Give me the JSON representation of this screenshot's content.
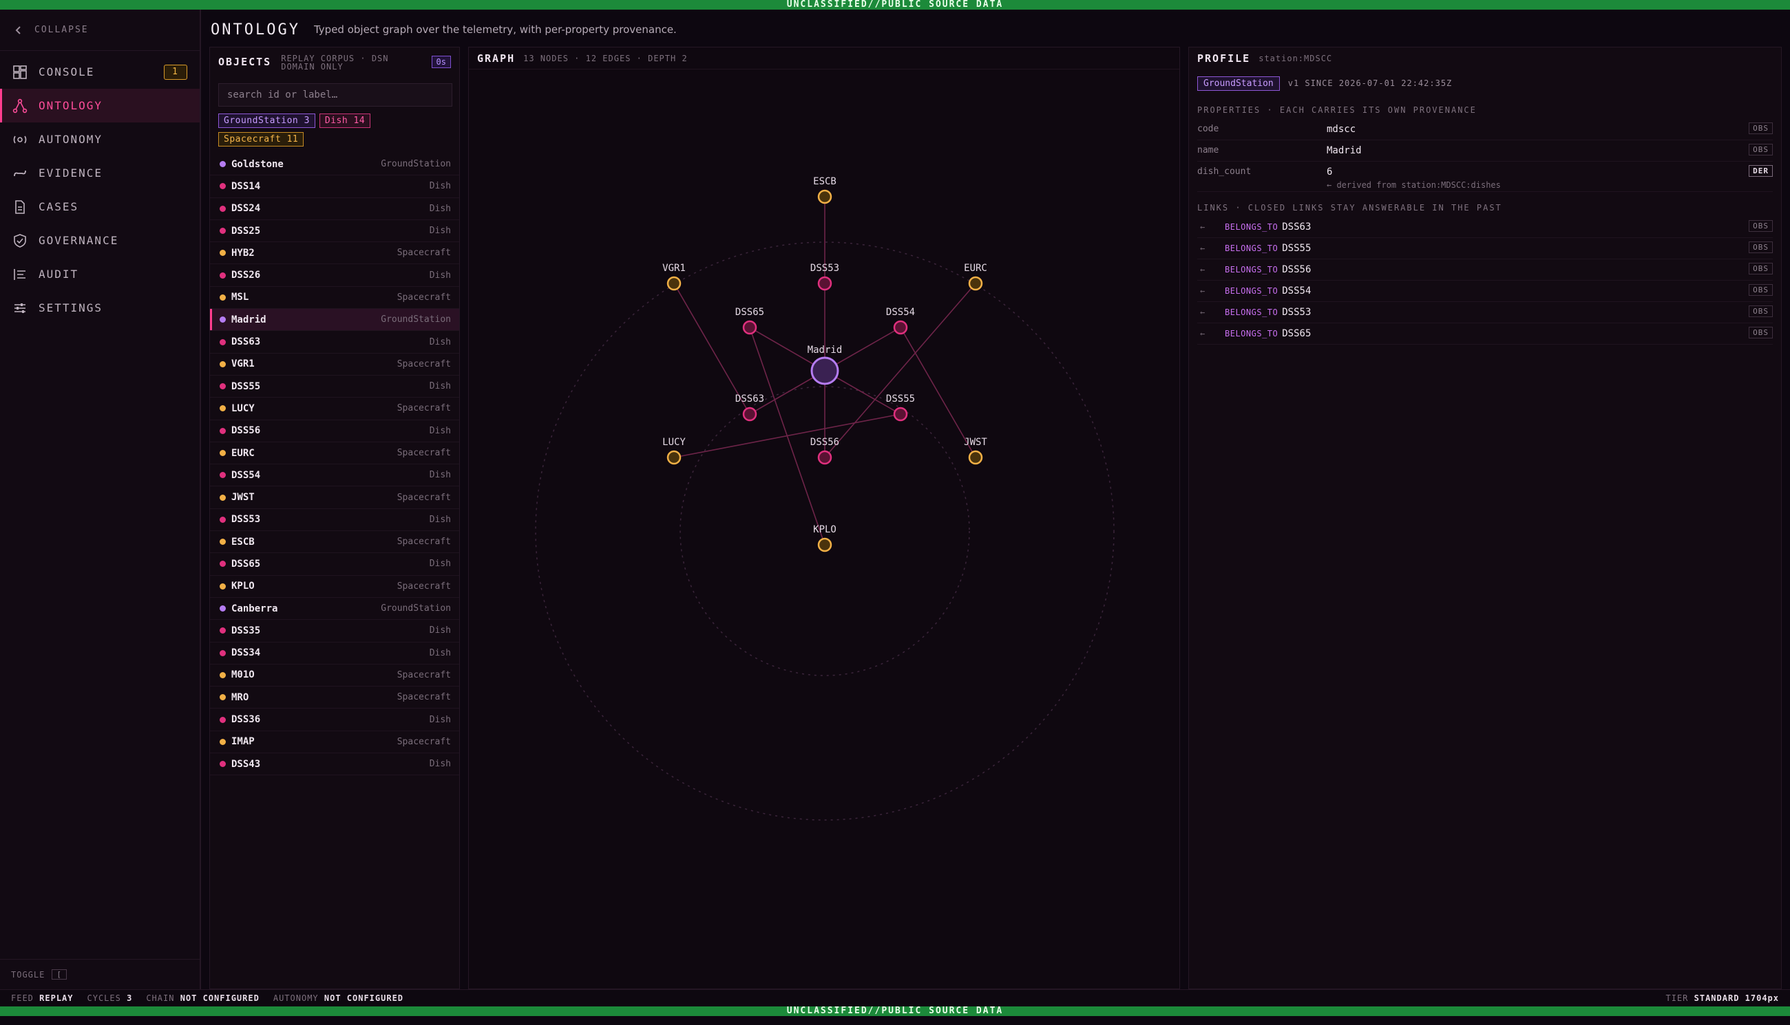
{
  "banner": "UNCLASSIFIED//PUBLIC SOURCE DATA",
  "sidebar": {
    "collapse_label": "COLLAPSE",
    "items": [
      {
        "label": "CONSOLE",
        "icon": "dashboard-icon",
        "badge": "1"
      },
      {
        "label": "ONTOLOGY",
        "icon": "graph-icon",
        "active": true
      },
      {
        "label": "AUTONOMY",
        "icon": "autonomy-icon"
      },
      {
        "label": "EVIDENCE",
        "icon": "link-icon"
      },
      {
        "label": "CASES",
        "icon": "document-icon"
      },
      {
        "label": "GOVERNANCE",
        "icon": "shield-icon"
      },
      {
        "label": "AUDIT",
        "icon": "list-icon"
      },
      {
        "label": "SETTINGS",
        "icon": "sliders-icon"
      }
    ],
    "toggle_label": "TOGGLE",
    "toggle_key": "["
  },
  "header": {
    "title": "ONTOLOGY",
    "subtitle": "Typed object graph over the telemetry, with per-property provenance."
  },
  "objects": {
    "title": "OBJECTS",
    "meta": "REPLAY CORPUS · DSN DOMAIN ONLY",
    "age": "0s",
    "search_placeholder": "search id or label…",
    "filters": [
      {
        "label": "GroundStation 3",
        "kind": "gs"
      },
      {
        "label": "Dish 14",
        "kind": "dish"
      },
      {
        "label": "Spacecraft 11",
        "kind": "sc"
      }
    ],
    "rows": [
      {
        "label": "Goldstone",
        "type": "GroundStation"
      },
      {
        "label": "DSS14",
        "type": "Dish"
      },
      {
        "label": "DSS24",
        "type": "Dish"
      },
      {
        "label": "DSS25",
        "type": "Dish"
      },
      {
        "label": "HYB2",
        "type": "Spacecraft"
      },
      {
        "label": "DSS26",
        "type": "Dish"
      },
      {
        "label": "MSL",
        "type": "Spacecraft"
      },
      {
        "label": "Madrid",
        "type": "GroundStation",
        "selected": true
      },
      {
        "label": "DSS63",
        "type": "Dish"
      },
      {
        "label": "VGR1",
        "type": "Spacecraft"
      },
      {
        "label": "DSS55",
        "type": "Dish"
      },
      {
        "label": "LUCY",
        "type": "Spacecraft"
      },
      {
        "label": "DSS56",
        "type": "Dish"
      },
      {
        "label": "EURC",
        "type": "Spacecraft"
      },
      {
        "label": "DSS54",
        "type": "Dish"
      },
      {
        "label": "JWST",
        "type": "Spacecraft"
      },
      {
        "label": "DSS53",
        "type": "Dish"
      },
      {
        "label": "ESCB",
        "type": "Spacecraft"
      },
      {
        "label": "DSS65",
        "type": "Dish"
      },
      {
        "label": "KPLO",
        "type": "Spacecraft"
      },
      {
        "label": "Canberra",
        "type": "GroundStation"
      },
      {
        "label": "DSS35",
        "type": "Dish"
      },
      {
        "label": "DSS34",
        "type": "Dish"
      },
      {
        "label": "M01O",
        "type": "Spacecraft"
      },
      {
        "label": "MRO",
        "type": "Spacecraft"
      },
      {
        "label": "DSS36",
        "type": "Dish"
      },
      {
        "label": "IMAP",
        "type": "Spacecraft"
      },
      {
        "label": "DSS43",
        "type": "Dish"
      }
    ]
  },
  "graph": {
    "title": "GRAPH",
    "meta": "13 NODES · 12 EDGES · DEPTH 2",
    "nodes": [
      {
        "id": "Madrid",
        "type": "GroundStation"
      },
      {
        "id": "ESCB",
        "type": "Spacecraft"
      },
      {
        "id": "DSS53",
        "type": "Dish"
      },
      {
        "id": "VGR1",
        "type": "Spacecraft"
      },
      {
        "id": "EURC",
        "type": "Spacecraft"
      },
      {
        "id": "DSS65",
        "type": "Dish"
      },
      {
        "id": "DSS54",
        "type": "Dish"
      },
      {
        "id": "DSS63",
        "type": "Dish"
      },
      {
        "id": "DSS55",
        "type": "Dish"
      },
      {
        "id": "LUCY",
        "type": "Spacecraft"
      },
      {
        "id": "DSS56",
        "type": "Dish"
      },
      {
        "id": "JWST",
        "type": "Spacecraft"
      },
      {
        "id": "KPLO",
        "type": "Spacecraft"
      }
    ],
    "edges": [
      [
        "Madrid",
        "DSS53"
      ],
      [
        "Madrid",
        "DSS54"
      ],
      [
        "Madrid",
        "DSS55"
      ],
      [
        "Madrid",
        "DSS56"
      ],
      [
        "Madrid",
        "DSS63"
      ],
      [
        "Madrid",
        "DSS65"
      ],
      [
        "DSS53",
        "ESCB"
      ],
      [
        "DSS63",
        "VGR1"
      ],
      [
        "DSS56",
        "EURC"
      ],
      [
        "DSS55",
        "LUCY"
      ],
      [
        "DSS54",
        "JWST"
      ],
      [
        "DSS65",
        "KPLO"
      ]
    ],
    "colors": {
      "GroundStation": "#b57cf2",
      "Dish": "#e0307e",
      "Spacecraft": "#f2b046"
    }
  },
  "profile": {
    "title": "PROFILE",
    "id": "station:MDSCC",
    "type_badge": "GroundStation",
    "version": "v1  SINCE 2026-07-01 22:42:35Z",
    "properties_title": "PROPERTIES · EACH CARRIES ITS OWN PROVENANCE",
    "properties": [
      {
        "key": "code",
        "value": "mdscc",
        "prov": "OBS"
      },
      {
        "key": "name",
        "value": "Madrid",
        "prov": "OBS"
      },
      {
        "key": "dish_count",
        "value": "6",
        "prov": "DER",
        "derived": "← derived from station:MDSCC:dishes"
      }
    ],
    "links_title": "LINKS · CLOSED LINKS STAY ANSWERABLE IN THE PAST",
    "links": [
      {
        "rel": "BELONGS_TO",
        "target": "DSS63",
        "prov": "OBS"
      },
      {
        "rel": "BELONGS_TO",
        "target": "DSS55",
        "prov": "OBS"
      },
      {
        "rel": "BELONGS_TO",
        "target": "DSS56",
        "prov": "OBS"
      },
      {
        "rel": "BELONGS_TO",
        "target": "DSS54",
        "prov": "OBS"
      },
      {
        "rel": "BELONGS_TO",
        "target": "DSS53",
        "prov": "OBS"
      },
      {
        "rel": "BELONGS_TO",
        "target": "DSS65",
        "prov": "OBS"
      }
    ]
  },
  "status": {
    "feed_label": "FEED",
    "feed_value": "REPLAY",
    "cycles_label": "CYCLES",
    "cycles_value": "3",
    "chain_label": "CHAIN",
    "chain_value": "NOT CONFIGURED",
    "autonomy_label": "AUTONOMY",
    "autonomy_value": "NOT CONFIGURED",
    "tier_label": "TIER",
    "tier_value": "STANDARD 1704px"
  }
}
